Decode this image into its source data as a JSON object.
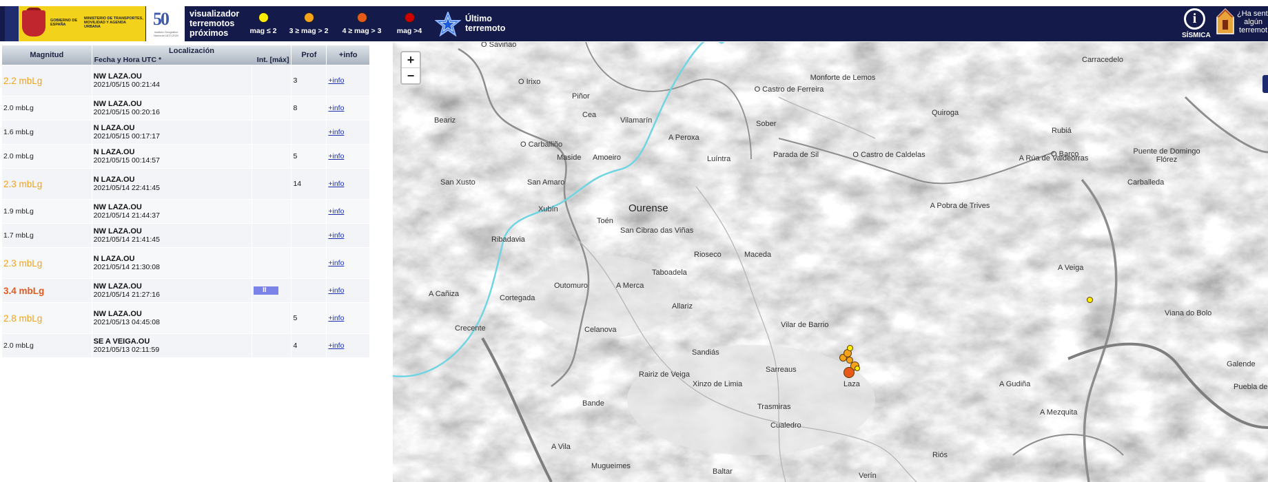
{
  "header": {
    "gov_text_1": "GOBIERNO DE ESPAÑA",
    "gov_text_2": "MINISTERIO DE TRANSPORTES, MOVILIDAD Y AGENDA URBANA",
    "anniversary_number": "50",
    "anniversary_text": "Instituto Geográfico Nacional 1870-2020",
    "app_title_line1": "visualizador",
    "app_title_line2": "terremotos",
    "app_title_line3": "próximos",
    "legend": [
      {
        "label": "mag ≤ 2",
        "color": "#ffee00"
      },
      {
        "label": "3 ≥ mag > 2",
        "color": "#f7a21b"
      },
      {
        "label": "4 ≥ mag > 3",
        "color": "#e85a1a"
      },
      {
        "label": "mag >4",
        "color": "#d00000"
      }
    ],
    "last_quake_line1": "Último",
    "last_quake_line2": "terremoto",
    "sismica_label": "SÍSMICA",
    "felt_line1": "¿Ha senti",
    "felt_line2": "algún",
    "felt_line3": "terremot"
  },
  "table": {
    "headers": {
      "magnitude": "Magnitud",
      "location": "Localización",
      "datetime": "Fecha y Hora UTC *",
      "intensity": "Int. [máx]",
      "depth": "Prof",
      "more": "+info"
    },
    "rows": [
      {
        "mag": "2.2 mbLg",
        "cls": "m23",
        "loc": "NW LAZA.OU",
        "dt": "2021/05/15 00:21:44",
        "int": "",
        "prof": "3",
        "more": "+info"
      },
      {
        "mag": "2.0 mbLg",
        "cls": "",
        "loc": "NW LAZA.OU",
        "dt": "2021/05/15 00:20:16",
        "int": "",
        "prof": "8",
        "more": "+info"
      },
      {
        "mag": "1.6 mbLg",
        "cls": "",
        "loc": "N LAZA.OU",
        "dt": "2021/05/15 00:17:17",
        "int": "",
        "prof": "",
        "more": "+info"
      },
      {
        "mag": "2.0 mbLg",
        "cls": "",
        "loc": "N LAZA.OU",
        "dt": "2021/05/15 00:14:57",
        "int": "",
        "prof": "5",
        "more": "+info"
      },
      {
        "mag": "2.3 mbLg",
        "cls": "m23",
        "loc": "N LAZA.OU",
        "dt": "2021/05/14 22:41:45",
        "int": "",
        "prof": "14",
        "more": "+info"
      },
      {
        "mag": "1.9 mbLg",
        "cls": "",
        "loc": "NW LAZA.OU",
        "dt": "2021/05/14 21:44:37",
        "int": "",
        "prof": "",
        "more": "+info"
      },
      {
        "mag": "1.7 mbLg",
        "cls": "",
        "loc": "NW LAZA.OU",
        "dt": "2021/05/14 21:41:45",
        "int": "",
        "prof": "",
        "more": "+info"
      },
      {
        "mag": "2.3 mbLg",
        "cls": "m23",
        "loc": "N LAZA.OU",
        "dt": "2021/05/14 21:30:08",
        "int": "",
        "prof": "",
        "more": "+info"
      },
      {
        "mag": "3.4 mbLg",
        "cls": "m34",
        "loc": "NW LAZA.OU",
        "dt": "2021/05/14 21:27:16",
        "int": "II",
        "prof": "",
        "more": "+info"
      },
      {
        "mag": "2.8 mbLg",
        "cls": "m23",
        "loc": "NW LAZA.OU",
        "dt": "2021/05/13 04:45:08",
        "int": "",
        "prof": "5",
        "more": "+info"
      },
      {
        "mag": "2.0 mbLg",
        "cls": "",
        "loc": "SE A VEIGA.OU",
        "dt": "2021/05/13 02:11:59",
        "int": "",
        "prof": "4",
        "more": "+info"
      }
    ]
  },
  "map": {
    "zoom_in": "+",
    "zoom_out": "−",
    "places": [
      {
        "name": "O Saviñao"
      },
      {
        "name": "O Irixo"
      },
      {
        "name": "Piñor"
      },
      {
        "name": "O Castro de Ferreira"
      },
      {
        "name": "Monforte de Lemos"
      },
      {
        "name": "Quiroga"
      },
      {
        "name": "Carracedelo"
      },
      {
        "name": "Beariz"
      },
      {
        "name": "Cea"
      },
      {
        "name": "Vilamarín"
      },
      {
        "name": "Sober"
      },
      {
        "name": "Rubiá"
      },
      {
        "name": "O Carballiño"
      },
      {
        "name": "Maside"
      },
      {
        "name": "Amoeiro"
      },
      {
        "name": "A Peroxa"
      },
      {
        "name": "Luíntra"
      },
      {
        "name": "Parada de Sil"
      },
      {
        "name": "O Castro de Caldelas"
      },
      {
        "name": "A Rúa de Valdeorras"
      },
      {
        "name": "O Barco"
      },
      {
        "name": "Puente de Domingo Flórez"
      },
      {
        "name": "San Xusto"
      },
      {
        "name": "San Amaro"
      },
      {
        "name": "Carballeda"
      },
      {
        "name": "Ourense"
      },
      {
        "name": "Xubín"
      },
      {
        "name": "Toén"
      },
      {
        "name": "A Pobra de Trives"
      },
      {
        "name": "Ribadavia"
      },
      {
        "name": "San Cibrao das Viñas"
      },
      {
        "name": "Rioseco"
      },
      {
        "name": "Maceda"
      },
      {
        "name": "Taboadela"
      },
      {
        "name": "A Veiga"
      },
      {
        "name": "A Cañiza"
      },
      {
        "name": "Outomuro"
      },
      {
        "name": "A Merca"
      },
      {
        "name": "Cortegada"
      },
      {
        "name": "Allariz"
      },
      {
        "name": "Viana do Bolo"
      },
      {
        "name": "Vilar de Barrio"
      },
      {
        "name": "Crecente"
      },
      {
        "name": "Celanova"
      },
      {
        "name": "Sandiás"
      },
      {
        "name": "Sarreaus"
      },
      {
        "name": "Galende"
      },
      {
        "name": "Rairiz de Veiga"
      },
      {
        "name": "Xinzo de Limia"
      },
      {
        "name": "Laza"
      },
      {
        "name": "A Gudiña"
      },
      {
        "name": "Puebla de"
      },
      {
        "name": "Bande"
      },
      {
        "name": "Trasmiras"
      },
      {
        "name": "A Mezquita"
      },
      {
        "name": "Cualedro"
      },
      {
        "name": "A Vila"
      },
      {
        "name": "Mugueimes"
      },
      {
        "name": "Riós"
      },
      {
        "name": "Baltar"
      },
      {
        "name": "Verín"
      }
    ]
  }
}
